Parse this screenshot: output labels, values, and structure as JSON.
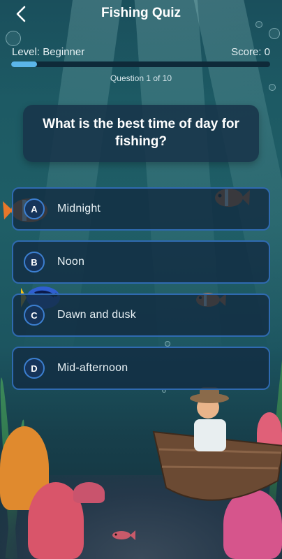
{
  "header": {
    "title": "Fishing Quiz",
    "back_icon": "chevron-left-icon"
  },
  "status": {
    "level": "Level: Beginner",
    "score": "Score: 0",
    "progress_fraction": 0.1,
    "counter": "Question 1 of 10"
  },
  "question": {
    "text": "What is the best time of day for fishing?"
  },
  "options": [
    {
      "letter": "A",
      "text": "Midnight"
    },
    {
      "letter": "B",
      "text": "Noon"
    },
    {
      "letter": "C",
      "text": "Dawn and dusk"
    },
    {
      "letter": "D",
      "text": "Mid-afternoon"
    }
  ],
  "colors": {
    "accent": "#5bb6ea",
    "option_border": "#2f6ab0",
    "card_bg": "#18344a"
  }
}
